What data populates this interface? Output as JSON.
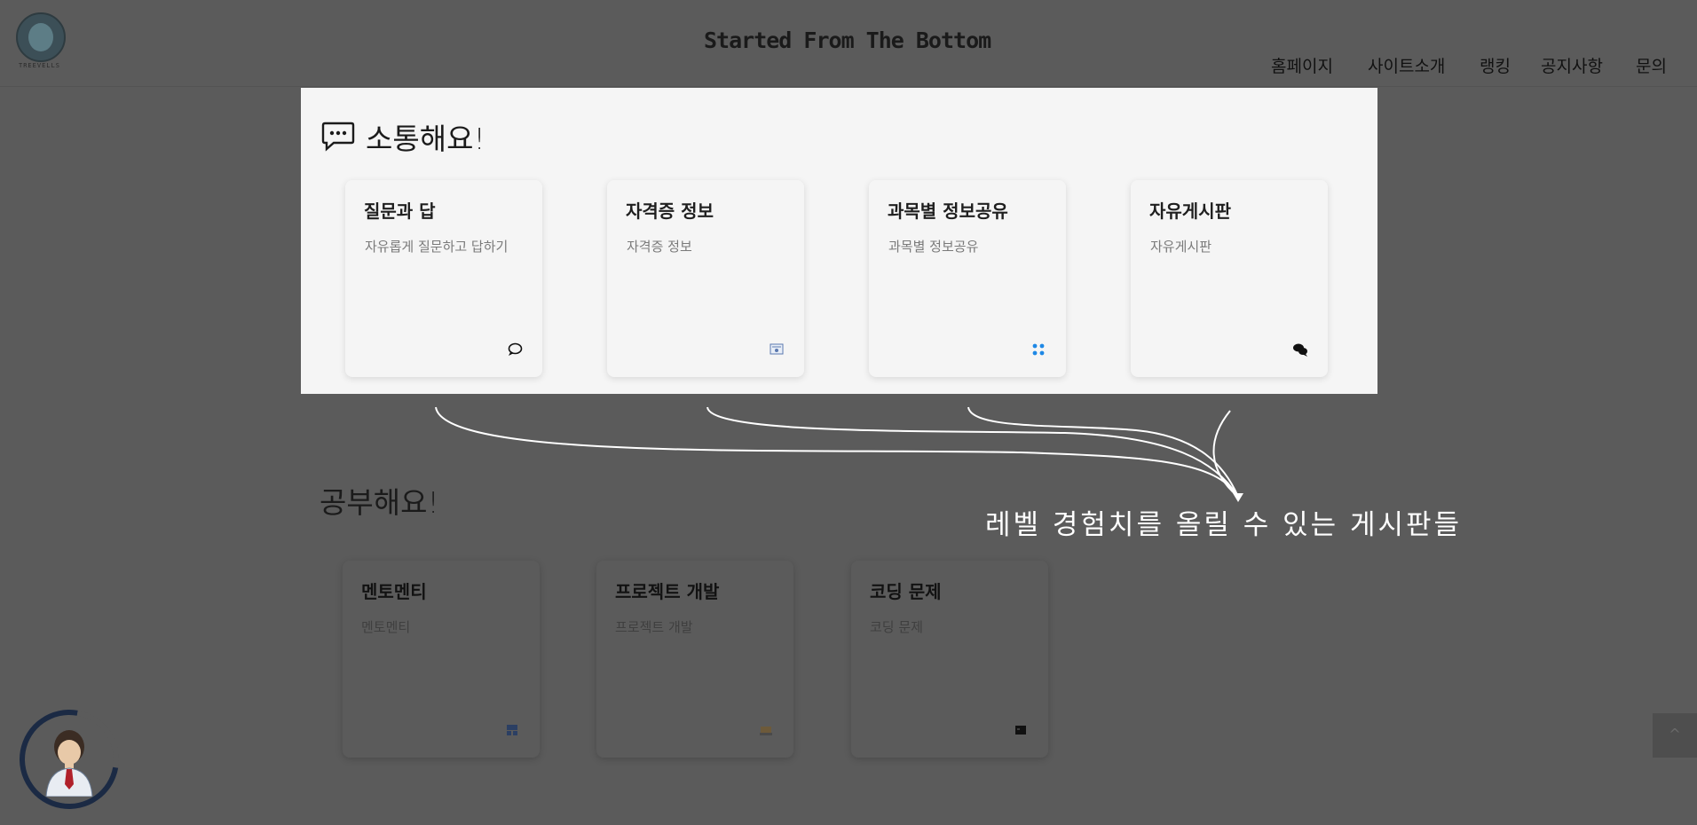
{
  "header": {
    "logo_caption": "TREEVELLS",
    "site_title": "Started From The Bottom",
    "nav": [
      "홈페이지",
      "사이트소개",
      "랭킹",
      "공지사항",
      "문의"
    ]
  },
  "communicate": {
    "title": "소통해요!",
    "icon": "chat-bubble-icon",
    "cards": [
      {
        "title": "질문과 답",
        "desc": "자유롭게 질문하고 답하기",
        "icon": "speech-bubble-icon"
      },
      {
        "title": "자격증 정보",
        "desc": "자격증 정보",
        "icon": "certificate-icon"
      },
      {
        "title": "과목별 정보공유",
        "desc": "과목별 정보공유",
        "icon": "share-dots-icon"
      },
      {
        "title": "자유게시판",
        "desc": "자유게시판",
        "icon": "chat-bubbles-icon"
      }
    ]
  },
  "study": {
    "title": "공부해요!",
    "cards": [
      {
        "title": "멘토멘티",
        "desc": "멘토멘티",
        "icon": "mentor-icon"
      },
      {
        "title": "프로젝트 개발",
        "desc": "프로젝트 개발",
        "icon": "project-icon"
      },
      {
        "title": "코딩 문제",
        "desc": "코딩 문제",
        "icon": "terminal-icon"
      }
    ]
  },
  "annotation": "레벨 경험치를 올릴 수 있는 게시판들",
  "scroll_top": "^"
}
